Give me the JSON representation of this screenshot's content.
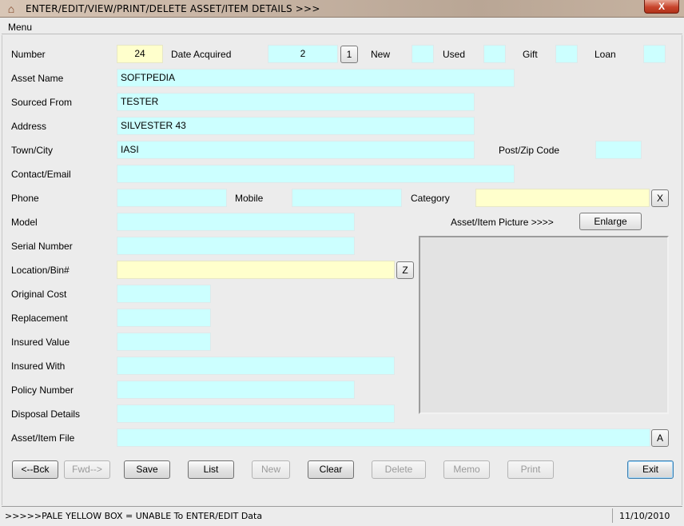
{
  "window": {
    "title": "ENTER/EDIT/VIEW/PRINT/DELETE ASSET/ITEM DETAILS >>>",
    "close_label": "X"
  },
  "menu": {
    "label": "Menu"
  },
  "labels": {
    "number": "Number",
    "date_acquired": "Date Acquired",
    "new": "New",
    "used": "Used",
    "gift": "Gift",
    "loan": "Loan",
    "asset_name": "Asset Name",
    "sourced_from": "Sourced From",
    "address": "Address",
    "town_city": "Town/City",
    "post_zip": "Post/Zip Code",
    "contact_email": "Contact/Email",
    "phone": "Phone",
    "mobile": "Mobile",
    "category": "Category",
    "model": "Model",
    "asset_picture": "Asset/Item Picture >>>>",
    "serial_number": "Serial Number",
    "location_bin": "Location/Bin#",
    "original_cost": "Original Cost",
    "replacement": "Replacement",
    "insured_value": "Insured Value",
    "insured_with": "Insured With",
    "policy_number": "Policy Number",
    "disposal_details": "Disposal Details",
    "asset_file": "Asset/Item File"
  },
  "values": {
    "number": "24",
    "date_acquired": "2",
    "new": "",
    "used": "",
    "gift": "",
    "loan": "",
    "asset_name": "SOFTPEDIA",
    "sourced_from": "TESTER",
    "address": "SILVESTER 43",
    "town_city": "IASI",
    "post_zip": "",
    "contact_email": "",
    "phone": "",
    "mobile": "",
    "category": "",
    "model": "",
    "serial_number": "",
    "location_bin": "",
    "original_cost": "",
    "replacement": "",
    "insured_value": "",
    "insured_with": "",
    "policy_number": "",
    "disposal_details": "",
    "asset_file": ""
  },
  "small_buttons": {
    "date_picker": "1",
    "category_clear": "X",
    "location_clear": "Z",
    "file_browse": "A",
    "enlarge": "Enlarge"
  },
  "buttons": {
    "back": "<--Bck",
    "forward": "Fwd-->",
    "save": "Save",
    "list": "List",
    "new": "New",
    "clear": "Clear",
    "delete": "Delete",
    "memo": "Memo",
    "print": "Print",
    "exit": "Exit"
  },
  "status": {
    "message": ">>>>>PALE YELLOW BOX = UNABLE To ENTER/EDIT Data",
    "date": "11/10/2010"
  },
  "colors": {
    "editable_field": "#ccffff",
    "readonly_field": "#ffffcc"
  }
}
